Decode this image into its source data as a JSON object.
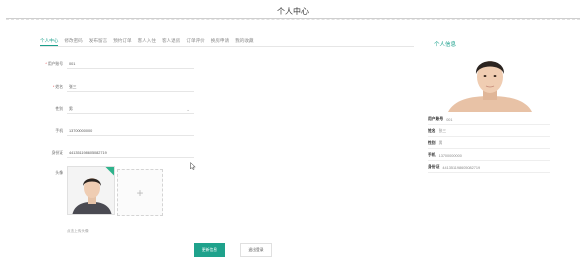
{
  "header": {
    "title": "个人中心"
  },
  "tabs": [
    {
      "label": "个人中心"
    },
    {
      "label": "修改密码"
    },
    {
      "label": "发布留言"
    },
    {
      "label": "预约订单"
    },
    {
      "label": "客人入住"
    },
    {
      "label": "客人退房"
    },
    {
      "label": "订单评价"
    },
    {
      "label": "换房申请"
    },
    {
      "label": "我的收藏"
    }
  ],
  "form": {
    "account": {
      "label": "用户账号",
      "required": true,
      "value": "001"
    },
    "name": {
      "label": "姓名",
      "required": true,
      "value": "张三"
    },
    "gender": {
      "label": "性别",
      "value": "男"
    },
    "phone": {
      "label": "手机",
      "value": "13700000000"
    },
    "id_card": {
      "label": "身份证",
      "value": "441351198605082719"
    },
    "avatar": {
      "label": "头像",
      "tip": "点击上传头像"
    }
  },
  "buttons": {
    "save": "更新信息",
    "logout": "退出登录"
  },
  "profile_panel": {
    "title": "个人信息",
    "rows": [
      {
        "key": "用户账号",
        "value": "001"
      },
      {
        "key": "姓名",
        "value": "张三"
      },
      {
        "key": "性别",
        "value": "男"
      },
      {
        "key": "手机",
        "value": "13700000000"
      },
      {
        "key": "身份证",
        "value": "441351198605082719"
      }
    ]
  },
  "colors": {
    "accent": "#1fa28c",
    "required": "#e04040"
  },
  "icons": {
    "add": "plus-icon",
    "select": "chevron-down-icon",
    "cursor": "mouse-pointer-icon"
  }
}
